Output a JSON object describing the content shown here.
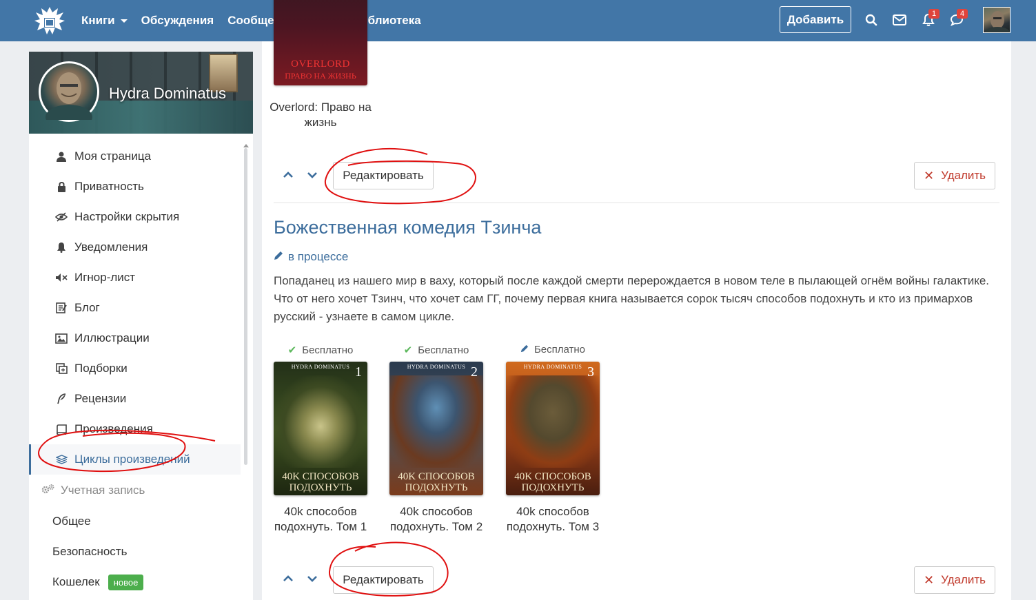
{
  "topbar": {
    "nav": [
      {
        "label": "Книги",
        "dropdown": true
      },
      {
        "label": "Обсуждения",
        "dropdown": false
      },
      {
        "label": "Сообщество",
        "dropdown": true
      },
      {
        "label": "Моя библиотека",
        "dropdown": false
      }
    ],
    "add_label": "Добавить",
    "notifications_count": "1",
    "messages_count": "4",
    "brand_color": "#4276a7"
  },
  "profile": {
    "name": "Hydra Dominatus"
  },
  "sidebar": {
    "items": [
      {
        "label": "Моя страница",
        "icon": "user-icon"
      },
      {
        "label": "Приватность",
        "icon": "lock-icon"
      },
      {
        "label": "Настройки скрытия",
        "icon": "eye-slash-icon"
      },
      {
        "label": "Уведомления",
        "icon": "bell-icon"
      },
      {
        "label": "Игнор-лист",
        "icon": "mute-icon"
      },
      {
        "label": "Блог",
        "icon": "blog-icon"
      },
      {
        "label": "Иллюстрации",
        "icon": "image-icon"
      },
      {
        "label": "Подборки",
        "icon": "collection-icon"
      },
      {
        "label": "Рецензии",
        "icon": "feather-icon"
      },
      {
        "label": "Произведения",
        "icon": "book-icon"
      },
      {
        "label": "Циклы произведений",
        "icon": "layers-icon",
        "active": true
      }
    ],
    "account_section": "Учетная запись",
    "account_items": [
      {
        "label": "Общее"
      },
      {
        "label": "Безопасность"
      },
      {
        "label": "Кошелек",
        "badge": "новое"
      }
    ]
  },
  "main": {
    "prev_book": {
      "cover_title": "OVERLORD",
      "cover_subtitle": "ПРАВО НА ЖИЗНЬ",
      "caption": "Overlord: Право на жизнь"
    },
    "edit_label": "Редактировать",
    "delete_label": "Удалить",
    "cycle": {
      "title": "Божественная комедия Тзинча",
      "status": "в процессе",
      "description": "Попаданец из нашего мир в ваху, который после каждой смерти перерождается в новом теле в пылающей огнём войны галактике. Что от него хочет Тзинч, что хочет сам ГГ, почему первая книга называется сорок тысяч способов подохнуть и кто из примархов русский - узнаете в самом цикле.",
      "books": [
        {
          "access": "Бесплатно",
          "access_icon": "check-icon",
          "author": "HYDRA DOMINATUS",
          "number": "1",
          "cover_line1": "40K СПОСОБОВ",
          "cover_line2": "ПОДОХНУТЬ",
          "caption": "40k способов подохнуть. Том 1"
        },
        {
          "access": "Бесплатно",
          "access_icon": "check-icon",
          "author": "HYDRA DOMINATUS",
          "number": "2",
          "cover_line1": "40K СПОСОБОВ",
          "cover_line2": "ПОДОХНУТЬ",
          "caption": "40k способов подохнуть. Том 2"
        },
        {
          "access": "Бесплатно",
          "access_icon": "pencil-icon",
          "author": "HYDRA DOMINATUS",
          "number": "3",
          "cover_line1": "40K СПОСОБОВ",
          "cover_line2": "ПОДОХНУТЬ",
          "caption": "40k способов подохнуть. Том 3"
        }
      ]
    }
  }
}
